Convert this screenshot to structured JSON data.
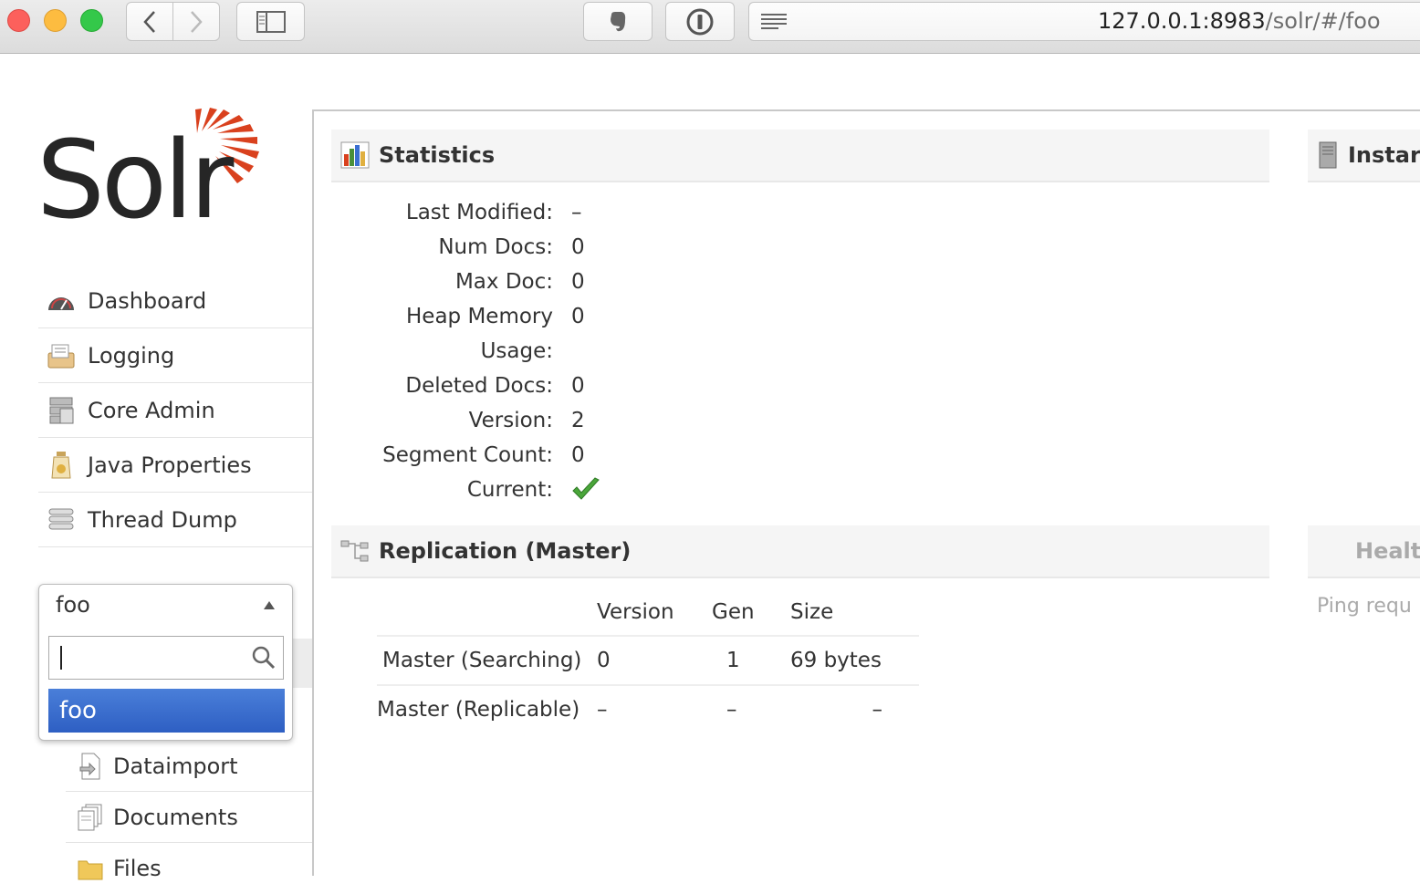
{
  "browser": {
    "url_host": "127.0.0.1:8983",
    "url_path": "/solr/#/foo"
  },
  "logo": {
    "text": "Solr"
  },
  "nav": {
    "items": [
      {
        "label": "Dashboard",
        "icon": "dashboard-icon"
      },
      {
        "label": "Logging",
        "icon": "logging-icon"
      },
      {
        "label": "Core Admin",
        "icon": "core-admin-icon"
      },
      {
        "label": "Java Properties",
        "icon": "java-properties-icon"
      },
      {
        "label": "Thread Dump",
        "icon": "thread-dump-icon"
      }
    ]
  },
  "core_selector": {
    "selected": "foo",
    "search_value": "",
    "options": [
      "foo"
    ]
  },
  "core_menu": {
    "items": [
      {
        "label": "Dataimport",
        "icon": "dataimport-icon"
      },
      {
        "label": "Documents",
        "icon": "documents-icon"
      },
      {
        "label": "Files",
        "icon": "files-icon"
      }
    ]
  },
  "statistics": {
    "title": "Statistics",
    "rows": [
      {
        "label": "Last Modified:",
        "value": "–"
      },
      {
        "label": "Num Docs:",
        "value": "0"
      },
      {
        "label": "Max Doc:",
        "value": "0"
      },
      {
        "label": "Heap Memory",
        "value": "0"
      },
      {
        "label": "Usage:",
        "value": ""
      },
      {
        "label": "Deleted Docs:",
        "value": "0"
      },
      {
        "label": "Version:",
        "value": "2"
      },
      {
        "label": "Segment Count:",
        "value": "0"
      },
      {
        "label": "Current:",
        "value": ""
      }
    ],
    "current_icon": "checkmark-icon"
  },
  "replication": {
    "title": "Replication (Master)",
    "columns": [
      "Version",
      "Gen",
      "Size"
    ],
    "rows": [
      {
        "name": "Master (Searching)",
        "version": "0",
        "gen": "1",
        "size": "69 bytes"
      },
      {
        "name": "Master (Replicable)",
        "version": "–",
        "gen": "–",
        "size": "–"
      }
    ]
  },
  "instance": {
    "title": "Instar"
  },
  "healthcheck": {
    "title": "Healtl",
    "text": "Ping requ"
  },
  "colors": {
    "accent": "#d9411e",
    "selected": "#3a6fd1",
    "check": "#4aa63a"
  }
}
